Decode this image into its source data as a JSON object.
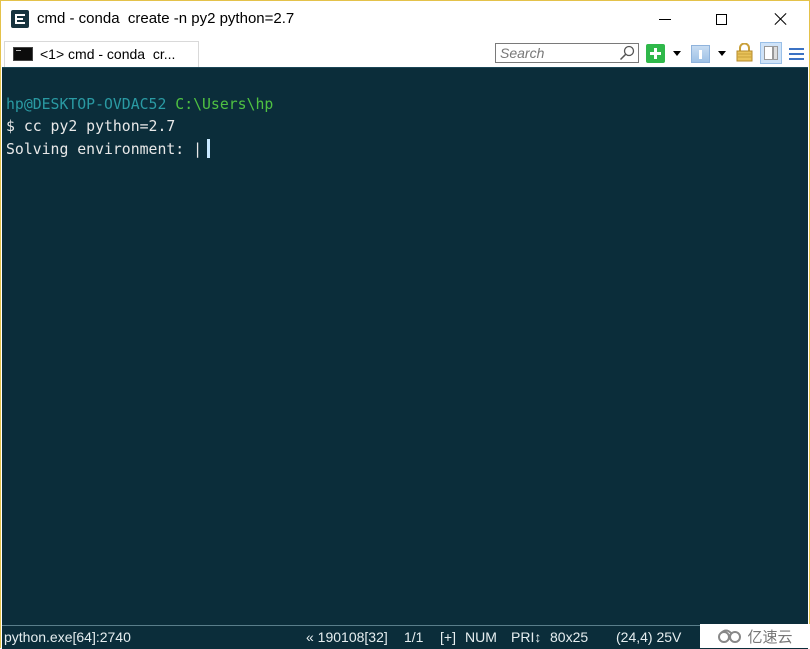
{
  "window": {
    "title": "cmd - conda  create -n py2 python=2.7",
    "controls": {
      "minimize": "minimize",
      "maximize": "maximize",
      "close": "close"
    }
  },
  "tabbar": {
    "tabs": [
      {
        "label": "<1> cmd - conda  cr...",
        "icon": "console-icon",
        "active": true
      }
    ],
    "search": {
      "placeholder": "Search",
      "value": ""
    },
    "toolbar": {
      "new_console_icon": "plus-icon",
      "tab_list_icon": "tabs-icon",
      "lock_icon": "lock-icon",
      "split_icon": "split-pane-icon",
      "menu_icon": "hamburger-menu-icon"
    }
  },
  "terminal": {
    "lines": [
      {
        "user_host": "hp@DESKTOP-OVDAC52",
        "path": "C:\\Users\\hp"
      },
      {
        "text": "$ cc py2 python=2.7"
      },
      {
        "text": "Solving environment: |"
      }
    ],
    "colors": {
      "background": "#0b2d3a",
      "user_host": "#2a9aa3",
      "path": "#4fc142",
      "text": "#e8e8e8"
    }
  },
  "statusbar": {
    "process": "python.exe[64]:2740",
    "version": "« 190108[32]",
    "console_index": "1/1",
    "insert_mode": "[+]",
    "num_lock": "NUM",
    "priority": "PRI↕",
    "size": "80x25",
    "cursor_pos": "(24,4) 25V"
  },
  "watermark": {
    "text": "亿速云"
  }
}
